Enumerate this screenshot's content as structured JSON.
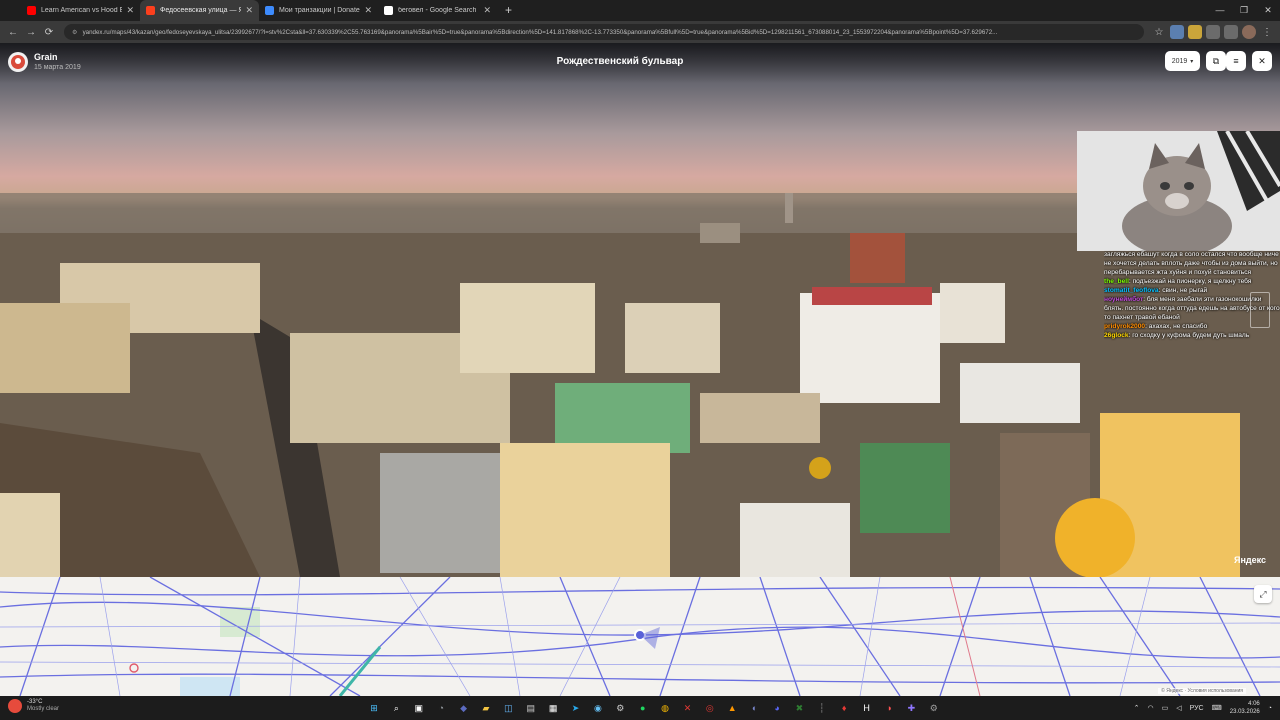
{
  "browser": {
    "tabs": [
      {
        "title": "Learn American vs Hood English",
        "favicon_color": "#ff0000"
      },
      {
        "title": "Федосеевская улица — Яндекс",
        "favicon_color": "#fc3f1d"
      },
      {
        "title": "Мои транзакции | DonatePay",
        "favicon_color": "#3d8bfd"
      },
      {
        "title": "беговел - Google Search",
        "favicon_color": "#ffffff"
      }
    ],
    "tab_close_glyph": "✕",
    "new_tab_glyph": "+",
    "window_controls": {
      "minimize": "—",
      "maximize": "❐",
      "close": "✕"
    },
    "nav": {
      "back": "←",
      "forward": "→",
      "reload": "⟳",
      "site_info": "⚙"
    },
    "url": "yandex.ru/maps/43/kazan/geo/fedoseyevskaya_ulitsa/23992677/?l=stv%2Csta&ll=37.630339%2C55.763169&panorama%5Bair%5D=true&panorama%5Bdirection%5D=141.817868%2C-13.773350&panorama%5Bfull%5D=true&panorama%5Bid%5D=1298211561_673088014_23_1553972204&panorama%5Bpoint%5D=37.629672...",
    "bookmark_glyph": "☆"
  },
  "panorama": {
    "author": "Grain",
    "date": "15 марта 2019",
    "title": "Рождественский бульвар",
    "year": "2019",
    "year_caret": "▾",
    "open_glyph": "⧉",
    "menu_glyph": "≡",
    "close_glyph": "✕",
    "brand": "Яндекс"
  },
  "stream": {
    "chat": [
      {
        "nick": "",
        "nick_color": "#ffffff",
        "text": "загляжься ебашут когда в соло остался что вообще ниче не хочется делать вплоть даже чтобы из дома выйти, но перебарывается жта хуйня и похуй становиться"
      },
      {
        "nick": "the_bell",
        "nick_color": "#7cfc00",
        "text": ": подъезжай на пионерку, я щелкну тебя"
      },
      {
        "nick": "stomatit_feoflova",
        "nick_color": "#00bfff",
        "text": ": свин, не рыгай"
      },
      {
        "nick": "ноунеймбот",
        "nick_color": "#c04ad8",
        "text": ": бля меня заебали эти газонокошилки блять. постоянно когда оттуда едешь на автобусе от кого то пахнет травой ебаной"
      },
      {
        "nick": "pridyrok2000",
        "nick_color": "#ff8c00",
        "text": ": ахахах, не спасибо"
      },
      {
        "nick": "26glock",
        "nick_color": "#ffd700",
        "text": ": го сходку у куфома будем дуть шмаль"
      }
    ]
  },
  "map": {
    "expand_glyph": "⤢",
    "copyright": "© Яндекс · Условия использования"
  },
  "taskbar": {
    "weather_temp": "-33°C",
    "weather_desc": "Mostly clear",
    "apps": [
      {
        "name": "start",
        "glyph": "⊞",
        "color": "#4cc2ff"
      },
      {
        "name": "search",
        "glyph": "⌕",
        "color": "#ffffff"
      },
      {
        "name": "task-view",
        "glyph": "▣",
        "color": "#ffffff"
      },
      {
        "name": "app-a",
        "glyph": "◔",
        "color": "#9aa0a6"
      },
      {
        "name": "app-b",
        "glyph": "◆",
        "color": "#5c6bc0"
      },
      {
        "name": "explorer",
        "glyph": "▰",
        "color": "#f4c542"
      },
      {
        "name": "app-c",
        "glyph": "◫",
        "color": "#64b5f6"
      },
      {
        "name": "app-d",
        "glyph": "▤",
        "color": "#cccccc"
      },
      {
        "name": "app-e",
        "glyph": "▦",
        "color": "#ffffff"
      },
      {
        "name": "telegram",
        "glyph": "➤",
        "color": "#29a9eb"
      },
      {
        "name": "steam",
        "glyph": "◉",
        "color": "#66c0f4"
      },
      {
        "name": "app-f",
        "glyph": "⚙",
        "color": "#cccccc"
      },
      {
        "name": "spotify",
        "glyph": "●",
        "color": "#1ed760"
      },
      {
        "name": "chrome",
        "glyph": "◍",
        "color": "#fbbc04"
      },
      {
        "name": "app-g",
        "glyph": "✕",
        "color": "#e53935"
      },
      {
        "name": "app-h",
        "glyph": "◎",
        "color": "#e53935"
      },
      {
        "name": "app-i",
        "glyph": "▲",
        "color": "#ff9800"
      },
      {
        "name": "app-j",
        "glyph": "◐",
        "color": "#7986cb"
      },
      {
        "name": "discord",
        "glyph": "◕",
        "color": "#5865f2"
      },
      {
        "name": "app-k",
        "glyph": "✖",
        "color": "#2e7d32"
      },
      {
        "name": "app-l",
        "glyph": "┆",
        "color": "#888888"
      },
      {
        "name": "app-m",
        "glyph": "♦",
        "color": "#e53935"
      },
      {
        "name": "app-n",
        "glyph": "H",
        "color": "#ffffff"
      },
      {
        "name": "app-o",
        "glyph": "◑",
        "color": "#ff5252"
      },
      {
        "name": "app-p",
        "glyph": "✚",
        "color": "#8f76ff"
      },
      {
        "name": "app-q",
        "glyph": "⚙",
        "color": "#9e9e9e"
      }
    ],
    "tray_caret": "⌃",
    "lang": "РУС",
    "time": "4:06",
    "date": "23.03.2026"
  }
}
